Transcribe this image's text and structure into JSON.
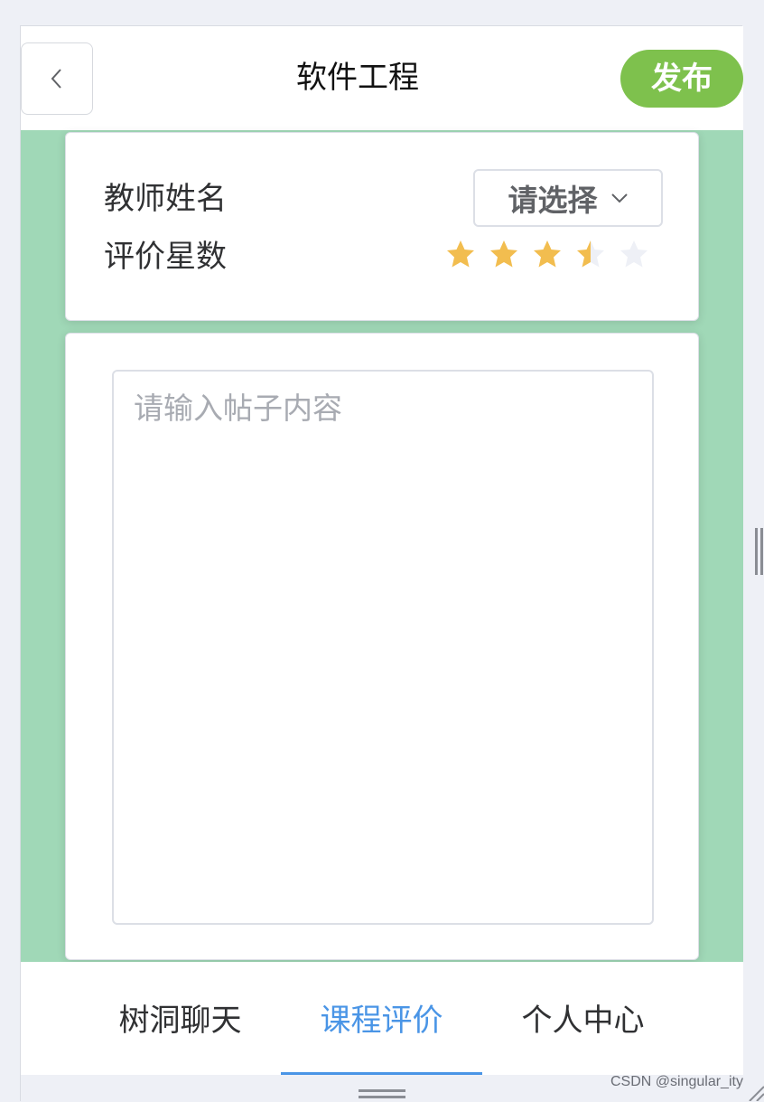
{
  "header": {
    "title": "软件工程",
    "publish_label": "发布",
    "back_icon": "chevron-left-icon"
  },
  "form": {
    "teacher_label": "教师姓名",
    "teacher_select": {
      "selected": "请选择",
      "icon": "chevron-down-icon"
    },
    "rating_label": "评价星数",
    "rating": {
      "value": 3.5,
      "max": 5
    },
    "post_placeholder": "请输入帖子内容",
    "post_value": ""
  },
  "tabbar": {
    "tabs": [
      {
        "label": "树洞聊天",
        "active": false
      },
      {
        "label": "课程评价",
        "active": true
      },
      {
        "label": "个人中心",
        "active": false
      }
    ]
  },
  "watermark": "CSDN @singular_ity",
  "colors": {
    "accent_green": "#7ec14d",
    "content_bg": "#a0d8b7",
    "star_filled": "#f2bd4f",
    "star_empty": "#eef0f6",
    "tab_active": "#4a95e6"
  }
}
